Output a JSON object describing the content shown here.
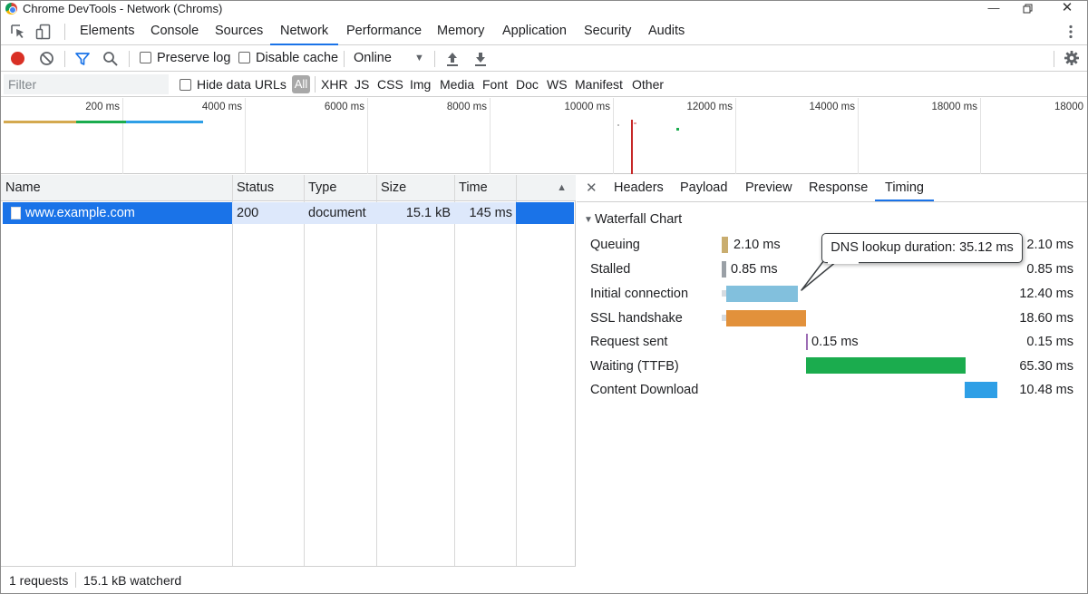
{
  "window": {
    "title": "Chrome DevTools - Network (Chroms)"
  },
  "tabs": [
    {
      "label": "Elements"
    },
    {
      "label": "Console"
    },
    {
      "label": "Sources"
    },
    {
      "label": "Network",
      "active": true
    },
    {
      "label": "Performance"
    },
    {
      "label": "Memory"
    },
    {
      "label": "Application"
    },
    {
      "label": "Security"
    },
    {
      "label": "Audits"
    }
  ],
  "toolbar": {
    "preserve_log": "Preserve log",
    "disable_cache": "Disable cache",
    "throttling": "Online"
  },
  "filter": {
    "placeholder": "Filter",
    "hide_data_urls": "Hide data URLs",
    "all": "All",
    "types": [
      "XHR",
      "JS",
      "CSS",
      "Img",
      "Media",
      "Font",
      "Doc",
      "WS",
      "Manifest",
      "Other"
    ]
  },
  "overview": {
    "ticks": [
      "200 ms",
      "4000 ms",
      "6000 ms",
      "8000 ms",
      "10000 ms",
      "12000 ms",
      "14000 ms",
      "18000 ms",
      "18000"
    ]
  },
  "requests": {
    "columns": [
      "Name",
      "Status",
      "Type",
      "Size",
      "Time"
    ],
    "rows": [
      {
        "name": "www.example.com",
        "status": "200",
        "type": "document",
        "size": "15.1 kB",
        "time": "145 ms"
      }
    ],
    "summary_count": "1 requests",
    "summary_size": "15.1 kB watcherd"
  },
  "detail": {
    "tabs": [
      "Headers",
      "Payload",
      "Preview",
      "Response",
      "Timing"
    ],
    "active_tab": "Timing",
    "section_title": "Waterfall Chart",
    "rows": [
      {
        "label": "Queuing",
        "bar_label": "2.10 ms",
        "value": "2.10 ms",
        "color": "#c9ad6f"
      },
      {
        "label": "Stalled",
        "bar_label": "0.85 ms",
        "value": "0.85 ms",
        "color": "#9aa0a6"
      },
      {
        "label": "Initial connection",
        "bar_label": "",
        "value": "12.40 ms",
        "color": "#82c0dd"
      },
      {
        "label": "SSL handshake",
        "bar_label": "",
        "value": "18.60 ms",
        "color": "#e2913b"
      },
      {
        "label": "Request sent",
        "bar_label": "0.15 ms",
        "value": "0.15 ms",
        "color": "#9c6cb4"
      },
      {
        "label": "Waiting (TTFB)",
        "bar_label": "",
        "value": "65.30 ms",
        "color": "#1bac4e"
      },
      {
        "label": "Content Download",
        "bar_label": "",
        "value": "10.48 ms",
        "color": "#2e9fe6"
      }
    ],
    "tooltip": "DNS lookup duration: 35.12 ms"
  }
}
